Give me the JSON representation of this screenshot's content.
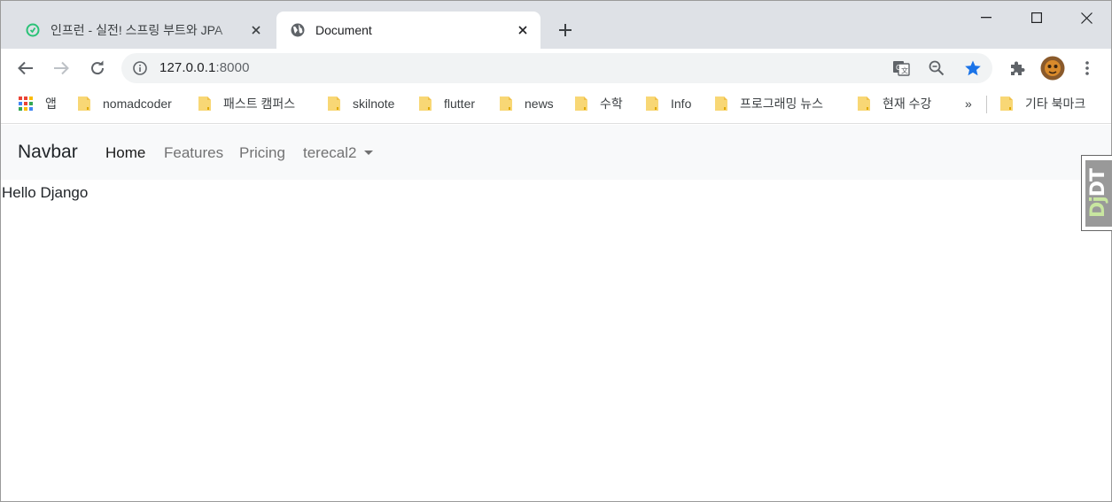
{
  "browser": {
    "tabs": [
      {
        "title": "인프런 - 실전! 스프링 부트와 JPA",
        "active": false,
        "icon": "inflearn-icon"
      },
      {
        "title": "Document",
        "active": true,
        "icon": "globe-icon"
      }
    ],
    "address_bar": {
      "host": "127.0.0.1",
      "port": ":8000"
    },
    "bookmarks": {
      "apps_label": "앱",
      "items": [
        "nomadcoder",
        "패스트 캠퍼스",
        "skilnote",
        "flutter",
        "news",
        "수학",
        "Info",
        "프로그래밍 뉴스",
        "현재 수강"
      ],
      "overflow_label": "»",
      "other_label": "기타 북마크"
    }
  },
  "page": {
    "navbar": {
      "brand": "Navbar",
      "links": [
        "Home",
        "Features",
        "Pricing"
      ],
      "dropdown": "terecal2"
    },
    "body_text": "Hello Django",
    "debug_toolbar": {
      "prefix": "Dj",
      "suffix": "DT"
    }
  },
  "colors": {
    "tabstrip": "#dee1e6",
    "omnibox": "#f1f3f4",
    "star": "#1a73e8",
    "navbar_bg": "#f8f9fa",
    "folder": "#f8d775"
  }
}
